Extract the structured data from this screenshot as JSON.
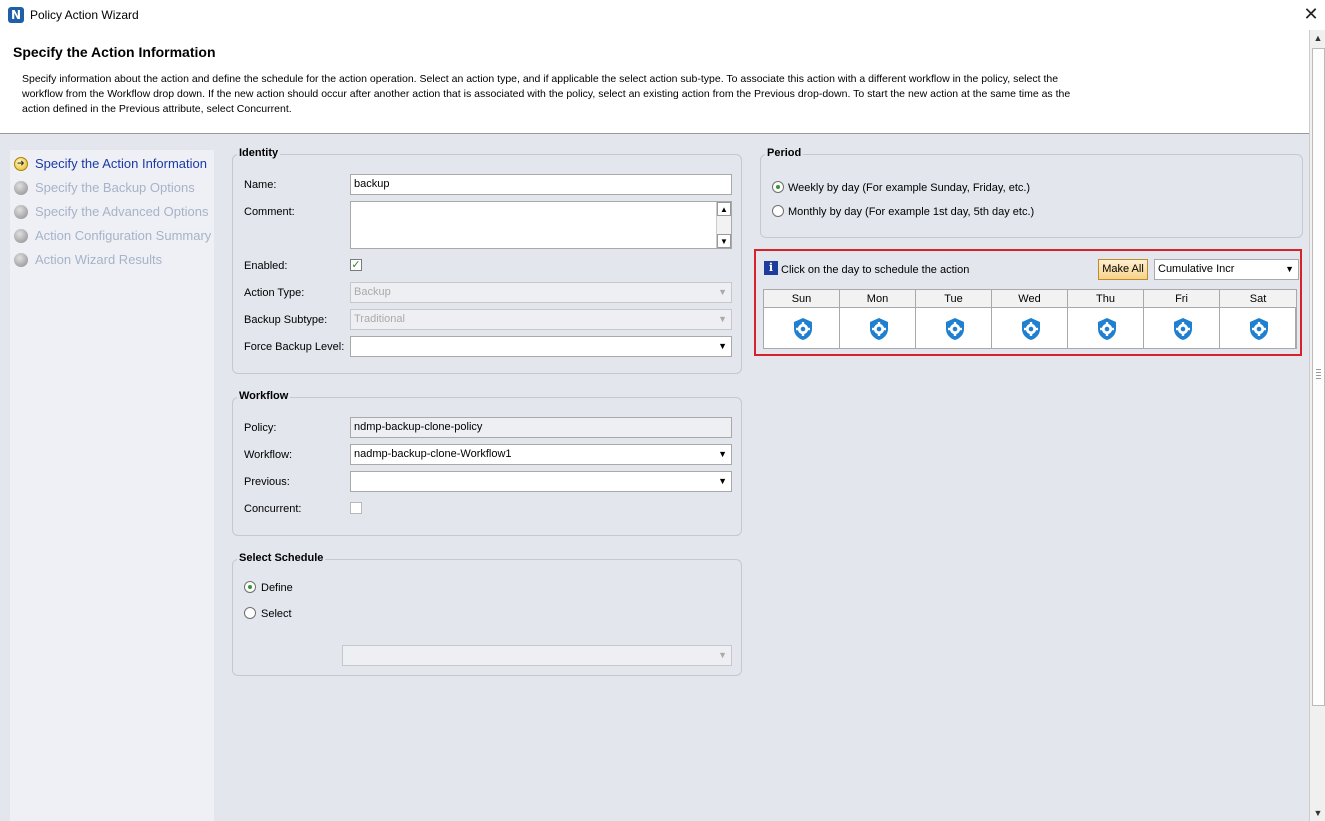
{
  "window": {
    "app_icon_letter": "N",
    "title": "Policy Action Wizard",
    "close_glyph": "✕"
  },
  "header": {
    "title": "Specify the Action Information",
    "description": "Specify information about the action and define the schedule for the action operation. Select an action type, and if applicable the select action sub-type. To associate this action with a different workflow in the policy, select the workflow from the Workflow drop down. If the new action should occur after another action that is associated with the policy, select an existing action from the Previous drop-down. To start the new action at the same time as the action defined in the Previous attribute, select Concurrent."
  },
  "nav": {
    "items": [
      {
        "label": "Specify the Action Information",
        "state": "current"
      },
      {
        "label": "Specify the Backup Options",
        "state": "pending"
      },
      {
        "label": "Specify the Advanced Options",
        "state": "pending"
      },
      {
        "label": "Action Configuration Summary",
        "state": "pending"
      },
      {
        "label": "Action Wizard Results",
        "state": "pending"
      }
    ]
  },
  "identity": {
    "legend": "Identity",
    "name_label": "Name:",
    "name_value": "backup",
    "comment_label": "Comment:",
    "comment_value": "",
    "enabled_label": "Enabled:",
    "enabled_checked": true,
    "enabled_mark": "✓",
    "action_type_label": "Action Type:",
    "action_type_value": "Backup",
    "backup_subtype_label": "Backup Subtype:",
    "backup_subtype_value": "Traditional",
    "force_level_label": "Force Backup Level:",
    "force_level_value": ""
  },
  "workflow": {
    "legend": "Workflow",
    "policy_label": "Policy:",
    "policy_value": "ndmp-backup-clone-policy",
    "workflow_label": "Workflow:",
    "workflow_value": "nadmp-backup-clone-Workflow1",
    "previous_label": "Previous:",
    "previous_value": "",
    "concurrent_label": "Concurrent:",
    "concurrent_checked": false
  },
  "select_schedule": {
    "legend": "Select Schedule",
    "define_label": "Define",
    "select_label": "Select",
    "selected": "Define",
    "schedule_value": ""
  },
  "period": {
    "legend": "Period",
    "weekly_label": "Weekly by day  (For example Sunday, Friday, etc.)",
    "monthly_label": "Monthly by day (For example 1st day, 5th day etc.)",
    "selected": "weekly"
  },
  "schedule": {
    "info_glyph": "i",
    "hint": "Click on the day to schedule the action",
    "make_all_label": "Make All",
    "level_value": "Cumulative Incr",
    "days": [
      "Sun",
      "Mon",
      "Tue",
      "Wed",
      "Thu",
      "Fri",
      "Sat"
    ],
    "day_icon": "gear-shield-icon",
    "accent_color": "#1f7fd0",
    "highlight_color": "#d8222a"
  },
  "glyphs": {
    "dropdown": "▼",
    "up": "▲",
    "down": "▼"
  }
}
